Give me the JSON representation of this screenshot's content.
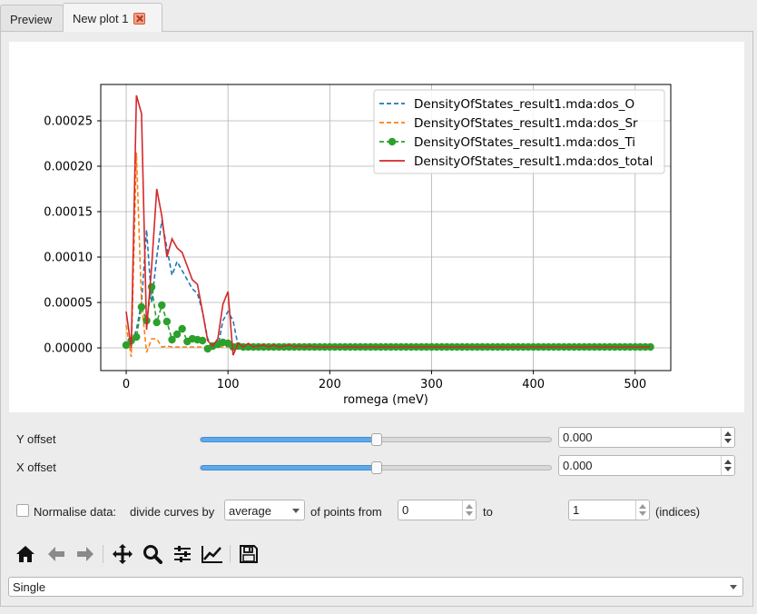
{
  "tabs": [
    {
      "label": "Preview",
      "active": false
    },
    {
      "label": "New plot 1",
      "active": true
    }
  ],
  "chart_data": {
    "type": "line",
    "xlabel": "romega (meV)",
    "ylabel": "",
    "xlim": [
      -25,
      535
    ],
    "ylim": [
      -2.5e-05,
      0.00029
    ],
    "xticks": [
      0,
      100,
      200,
      300,
      400,
      500
    ],
    "xtick_labels": [
      "0",
      "100",
      "200",
      "300",
      "400",
      "500"
    ],
    "yticks": [
      0,
      5e-05,
      0.0001,
      0.00015,
      0.0002,
      0.00025
    ],
    "ytick_labels": [
      "0.00000",
      "0.00005",
      "0.00010",
      "0.00015",
      "0.00020",
      "0.00025"
    ],
    "grid": true,
    "legend_position": "top-right",
    "x": [
      0,
      5,
      10,
      15,
      20,
      25,
      30,
      35,
      40,
      45,
      50,
      55,
      60,
      65,
      70,
      75,
      80,
      85,
      90,
      95,
      100,
      105,
      110,
      115,
      120,
      125,
      130,
      135,
      140,
      145,
      150,
      155,
      160,
      165,
      170,
      175,
      180,
      185,
      190,
      195,
      200,
      205,
      210,
      215,
      220,
      225,
      230,
      235,
      240,
      245,
      250,
      255,
      260,
      265,
      270,
      275,
      280,
      285,
      290,
      295,
      300,
      305,
      310,
      315,
      320,
      325,
      330,
      335,
      340,
      345,
      350,
      355,
      360,
      365,
      370,
      375,
      380,
      385,
      390,
      395,
      400,
      405,
      410,
      415,
      420,
      425,
      430,
      435,
      440,
      445,
      450,
      455,
      460,
      465,
      470,
      475,
      480,
      485,
      490,
      495,
      500,
      505,
      510,
      515
    ],
    "series": [
      {
        "name": "DensityOfStates_result1.mda:dos_O",
        "color": "#1f77b4",
        "style": "dashed",
        "values": [
          5e-06,
          4e-06,
          2e-05,
          5e-05,
          0.00013,
          5e-05,
          0.0001,
          0.00014,
          0.00011,
          8e-05,
          9.5e-05,
          8.5e-05,
          7.5e-05,
          6.5e-05,
          6e-05,
          4e-05,
          1e-05,
          1e-06,
          1e-06,
          3e-05,
          4e-05,
          3e-05,
          2e-06,
          3e-06,
          2e-06,
          2e-06,
          2e-06,
          2e-06,
          1e-06,
          1e-06,
          1e-06,
          1e-06,
          1e-06,
          1e-06,
          1e-06,
          1e-06,
          1e-06,
          1e-06,
          1e-06,
          1e-06,
          1e-06,
          1e-06,
          1e-06,
          1e-06,
          1e-06,
          1e-06,
          1e-06,
          1e-06,
          1e-06,
          1e-06,
          1e-06,
          1e-06,
          1e-06,
          1e-06,
          1e-06,
          1e-06,
          1e-06,
          1e-06,
          1e-06,
          1e-06,
          1e-06,
          1e-06,
          1e-06,
          1e-06,
          1e-06,
          1e-06,
          1e-06,
          1e-06,
          1e-06,
          1e-06,
          1e-06,
          1e-06,
          1e-06,
          1e-06,
          1e-06,
          1e-06,
          1e-06,
          1e-06,
          1e-06,
          1e-06,
          1e-06,
          1e-06,
          1e-06,
          1e-06,
          1e-06,
          1e-06,
          1e-06,
          1e-06,
          1e-06,
          1e-06,
          1e-06,
          1e-06,
          1e-06,
          1e-06,
          1e-06,
          1e-06,
          1e-06,
          1e-06,
          1e-06,
          1e-06,
          1e-06,
          1e-06,
          1e-06,
          1e-06
        ]
      },
      {
        "name": "DensityOfStates_result1.mda:dos_Sr",
        "color": "#ff7f0e",
        "style": "dashed",
        "values": [
          2.5e-05,
          -1e-05,
          0.000215,
          5e-05,
          -5e-06,
          1e-05,
          1e-05,
          1e-06,
          2e-06,
          1e-06,
          1e-06,
          1e-06,
          1e-06,
          1e-06,
          1e-06,
          1e-06,
          1e-06,
          1e-06,
          1e-06,
          1e-06,
          1e-06,
          1e-06,
          1e-06,
          1e-06,
          1e-06,
          1e-06,
          1e-06,
          1e-06,
          1e-06,
          1e-06,
          1e-06,
          1e-06,
          1e-06,
          1e-06,
          1e-06,
          1e-06,
          1e-06,
          1e-06,
          1e-06,
          1e-06,
          1e-06,
          1e-06,
          1e-06,
          1e-06,
          1e-06,
          1e-06,
          1e-06,
          1e-06,
          1e-06,
          1e-06,
          1e-06,
          1e-06,
          1e-06,
          1e-06,
          1e-06,
          1e-06,
          1e-06,
          1e-06,
          1e-06,
          1e-06,
          1e-06,
          1e-06,
          1e-06,
          1e-06,
          1e-06,
          1e-06,
          1e-06,
          1e-06,
          1e-06,
          1e-06,
          1e-06,
          1e-06,
          1e-06,
          1e-06,
          1e-06,
          1e-06,
          1e-06,
          1e-06,
          1e-06,
          1e-06,
          1e-06,
          1e-06,
          1e-06,
          1e-06,
          1e-06,
          1e-06,
          1e-06,
          1e-06,
          1e-06,
          1e-06,
          1e-06,
          1e-06,
          1e-06,
          1e-06,
          1e-06,
          1e-06,
          1e-06,
          1e-06,
          1e-06,
          1e-06,
          1e-06,
          1e-06,
          1e-06,
          1e-06
        ]
      },
      {
        "name": "DensityOfStates_result1.mda:dos_Ti",
        "color": "#2ca02c",
        "style": "dashed-marker",
        "values": [
          3e-06,
          8e-06,
          1.2e-05,
          4.5e-05,
          3e-05,
          6.7e-05,
          2.8e-05,
          4.7e-05,
          2.9e-05,
          9e-06,
          1.5e-05,
          2.1e-05,
          7e-06,
          1e-05,
          9e-06,
          8e-06,
          -1e-06,
          2e-06,
          4e-06,
          6e-06,
          5e-06,
          1e-06,
          2e-06,
          1e-06,
          1e-06,
          1e-06,
          1e-06,
          1e-06,
          1e-06,
          1e-06,
          1e-06,
          1e-06,
          1e-06,
          1e-06,
          1e-06,
          1e-06,
          1e-06,
          1e-06,
          1e-06,
          1e-06,
          1e-06,
          1e-06,
          1e-06,
          1e-06,
          1e-06,
          1e-06,
          1e-06,
          1e-06,
          1e-06,
          1e-06,
          1e-06,
          1e-06,
          1e-06,
          1e-06,
          1e-06,
          1e-06,
          1e-06,
          1e-06,
          1e-06,
          1e-06,
          1e-06,
          1e-06,
          1e-06,
          1e-06,
          1e-06,
          1e-06,
          1e-06,
          1e-06,
          1e-06,
          1e-06,
          1e-06,
          1e-06,
          1e-06,
          1e-06,
          1e-06,
          1e-06,
          1e-06,
          1e-06,
          1e-06,
          1e-06,
          1e-06,
          1e-06,
          1e-06,
          1e-06,
          1e-06,
          1e-06,
          1e-06,
          1e-06,
          1e-06,
          1e-06,
          1e-06,
          1e-06,
          1e-06,
          1e-06,
          1e-06,
          1e-06,
          1e-06,
          1e-06,
          1e-06,
          1e-06,
          1e-06,
          1e-06,
          1e-06,
          1e-06
        ]
      },
      {
        "name": "DensityOfStates_result1.mda:dos_total",
        "color": "#d62728",
        "style": "solid",
        "values": [
          4e-05,
          0.0,
          0.000278,
          0.000258,
          2e-05,
          9e-05,
          0.000175,
          0.000145,
          0.0001,
          0.00012,
          0.00011,
          0.000105,
          9e-05,
          7.5e-05,
          7e-05,
          4e-05,
          8e-06,
          2e-06,
          1e-05,
          4.8e-05,
          6.2e-05,
          -8e-06,
          5e-06,
          1e-06,
          5e-06,
          1e-06,
          2e-06,
          3e-06,
          1e-06,
          3e-06,
          1e-06,
          2e-06,
          3e-06,
          1e-06,
          2e-06,
          1e-06,
          2e-06,
          1e-06,
          1e-06,
          1e-06,
          1e-06,
          1e-06,
          1e-06,
          1e-06,
          1e-06,
          1e-06,
          1e-06,
          1e-06,
          1e-06,
          1e-06,
          1e-06,
          1e-06,
          1e-06,
          1e-06,
          1e-06,
          1e-06,
          1e-06,
          1e-06,
          1e-06,
          1e-06,
          1e-06,
          1e-06,
          1e-06,
          1e-06,
          1e-06,
          1e-06,
          1e-06,
          1e-06,
          1e-06,
          1e-06,
          1e-06,
          1e-06,
          1e-06,
          1e-06,
          1e-06,
          1e-06,
          1e-06,
          1e-06,
          1e-06,
          1e-06,
          1e-06,
          1e-06,
          1e-06,
          1e-06,
          1e-06,
          1e-06,
          1e-06,
          1e-06,
          1e-06,
          1e-06,
          1e-06,
          1e-06,
          1e-06,
          1e-06,
          1e-06,
          1e-06,
          1e-06,
          1e-06,
          1e-06,
          1e-06,
          1e-06,
          1e-06,
          1e-06,
          1e-06
        ]
      }
    ]
  },
  "controls": {
    "y_offset_label": "Y offset",
    "y_offset_value": "0.000",
    "y_offset_slider": 0.5,
    "x_offset_label": "X offset",
    "x_offset_value": "0.000",
    "x_offset_slider": 0.5,
    "normalise_label": "Normalise data:",
    "normalise_checked": false,
    "divide_label": "divide curves by",
    "divide_value": "average",
    "points_from_label": "of points from",
    "from_value": "0",
    "to_label": "to",
    "to_value": "1",
    "indices_label": "(indices)"
  },
  "toolbar": {
    "icons": [
      "home-icon",
      "back-arrow-icon",
      "forward-arrow-icon",
      "pan-icon",
      "zoom-icon",
      "configure-subplots-icon",
      "edit-axis-icon",
      "save-icon"
    ]
  },
  "mode_select": {
    "value": "Single"
  }
}
